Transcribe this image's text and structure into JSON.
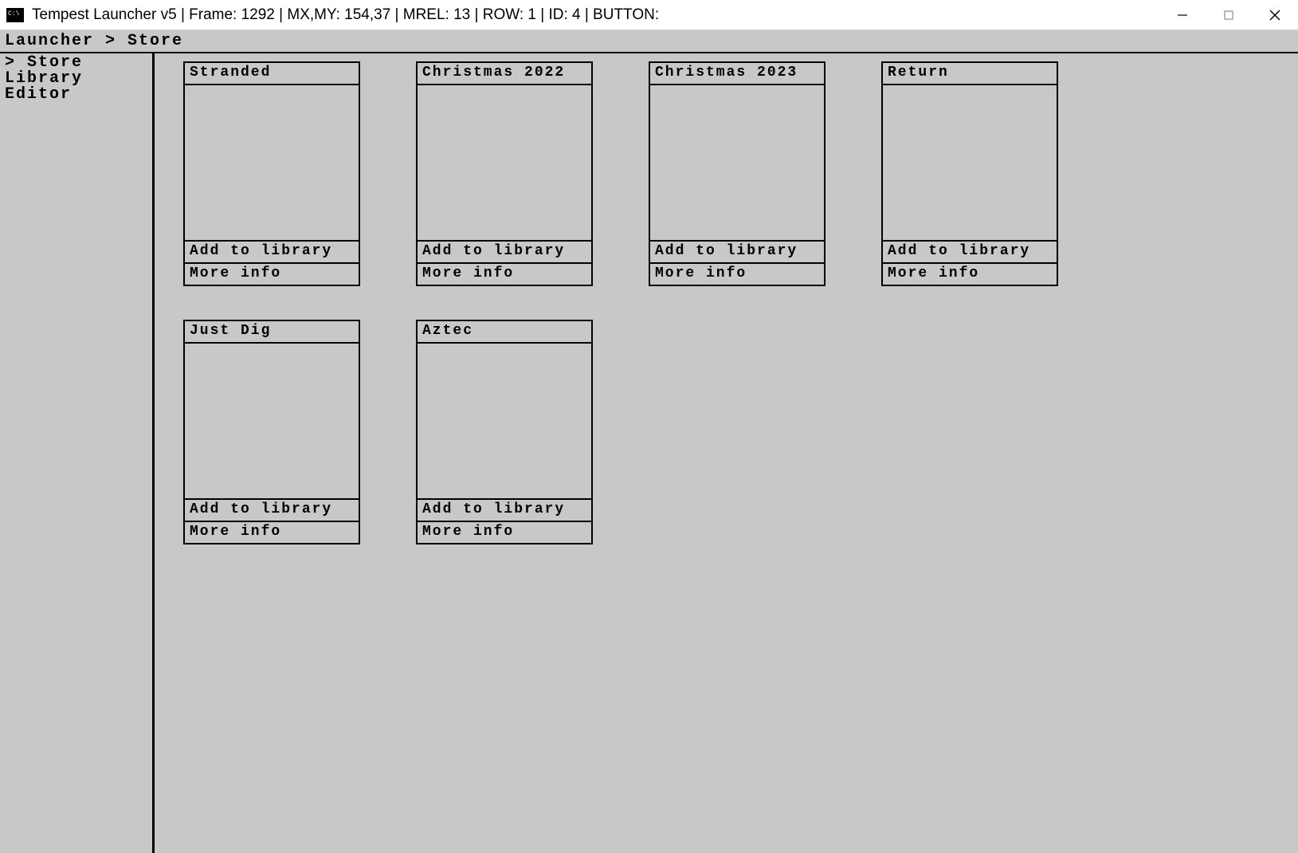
{
  "window": {
    "title": "Tempest Launcher v5 | Frame: 1292 | MX,MY: 154,37 | MREL: 13 | ROW: 1 | ID: 4 | BUTTON:"
  },
  "breadcrumb": {
    "text": "Launcher > Store"
  },
  "sidebar": {
    "items": [
      {
        "label": "> Store"
      },
      {
        "label": "Library"
      },
      {
        "label": "Editor"
      }
    ]
  },
  "buttons": {
    "add_to_library": "Add to library",
    "more_info": "More info"
  },
  "store": {
    "items": [
      {
        "title": "Stranded"
      },
      {
        "title": "Christmas 2022"
      },
      {
        "title": "Christmas 2023"
      },
      {
        "title": "Return"
      },
      {
        "title": "Just Dig"
      },
      {
        "title": "Aztec"
      }
    ]
  }
}
